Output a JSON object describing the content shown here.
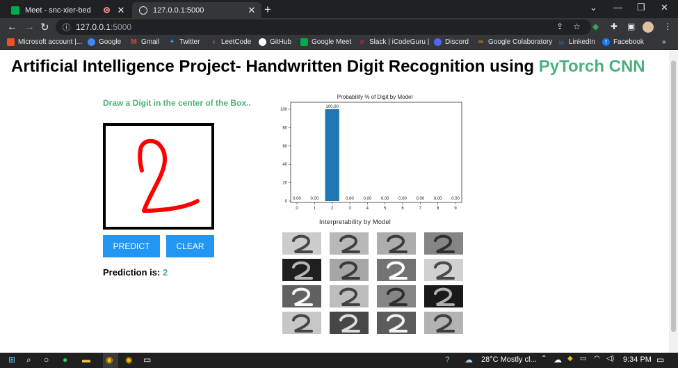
{
  "browser": {
    "tabs": [
      {
        "title": "Meet - snc-xier-bed",
        "icon": "google-meet-icon",
        "recording": true
      },
      {
        "title": "127.0.0.1:5000",
        "icon": "globe-icon",
        "active": true
      }
    ],
    "url_host": "127.0.0.1",
    "url_port": ":5000",
    "bookmarks": [
      {
        "label": "Microsoft account |...",
        "icon": "microsoft-icon",
        "color": "#f25022"
      },
      {
        "label": "Google",
        "icon": "google-icon",
        "color": "#4285f4"
      },
      {
        "label": "Gmail",
        "icon": "gmail-icon",
        "color": "#ea4335"
      },
      {
        "label": "Twitter",
        "icon": "twitter-icon",
        "color": "#1da1f2"
      },
      {
        "label": "LeetCode",
        "icon": "leetcode-icon",
        "color": "#ffa116"
      },
      {
        "label": "GitHub",
        "icon": "github-icon",
        "color": "#ffffff"
      },
      {
        "label": "Google Meet",
        "icon": "google-meet-icon",
        "color": "#00ac47"
      },
      {
        "label": "Slack | iCodeGuru |",
        "icon": "slack-icon",
        "color": "#e01e5a"
      },
      {
        "label": "Discord",
        "icon": "discord-icon",
        "color": "#5865f2"
      },
      {
        "label": "Google Colaboratory",
        "icon": "colab-icon",
        "color": "#f9ab00"
      },
      {
        "label": "LinkedIn",
        "icon": "linkedin-icon",
        "color": "#0a66c2"
      },
      {
        "label": "Facebook",
        "icon": "facebook-icon",
        "color": "#1877f2"
      }
    ]
  },
  "page": {
    "title_main": "Artificial Intelligence Project- Handwritten Digit Recognition using ",
    "title_accent": "PyTorch CNN",
    "instruction": "Draw a Digit in the center of the Box..",
    "predict_label": "PREDICT",
    "clear_label": "CLEAR",
    "prediction_label": "Prediction is: ",
    "prediction_value": "2",
    "interp_title": "Interpretability by Model",
    "accent_color": "#4caf7c",
    "button_color": "#2196f3"
  },
  "chart_data": {
    "type": "bar",
    "title": "Probability % of Digit by Model",
    "categories": [
      "0",
      "1",
      "2",
      "3",
      "4",
      "5",
      "6",
      "7",
      "8",
      "9"
    ],
    "values": [
      0,
      0,
      100,
      0,
      0,
      0,
      0,
      0,
      0,
      0
    ],
    "data_labels": [
      "0.00",
      "0.00",
      "100.00",
      "0.00",
      "0.00",
      "0.00",
      "0.00",
      "0.00",
      "0.00",
      "0.00"
    ],
    "ylim": [
      0,
      100
    ],
    "yticks": [
      "0",
      "20",
      "40",
      "60",
      "80",
      "100"
    ],
    "bar_color": "#1f77b4"
  },
  "interp_grid": [
    [
      0.8,
      0.72,
      0.68,
      0.52
    ],
    [
      0.12,
      0.65,
      0.45,
      0.82
    ],
    [
      0.38,
      0.74,
      0.52,
      0.1
    ],
    [
      0.78,
      0.28,
      0.36,
      0.7
    ]
  ],
  "taskbar": {
    "weather": "28°C  Mostly cl...",
    "time": "9:34 PM"
  }
}
